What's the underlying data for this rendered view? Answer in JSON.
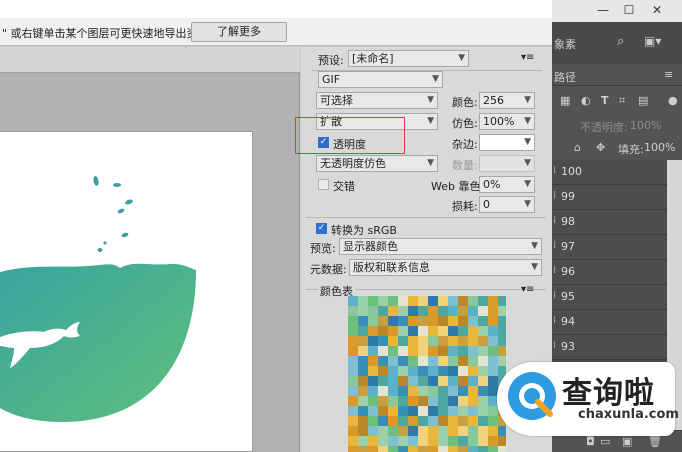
{
  "topbar": {
    "hint": "\" 或右键单击某个图层可更快速地导出资源",
    "learn_more": "了解更多"
  },
  "settings": {
    "preset_label": "预设:",
    "preset_value": "[未命名]",
    "format_value": "GIF",
    "reduction_value": "可选择",
    "colors_label": "颜色:",
    "colors_value": "256",
    "dither_algo_value": "扩散",
    "dither_label": "仿色:",
    "dither_value": "100%",
    "transparency_label": "透明度",
    "matte_label": "杂边:",
    "transparency_dither_value": "无透明度仿色",
    "amount_label": "数量:",
    "interlaced_label": "交错",
    "web_snap_label": "Web 靠色:",
    "web_snap_value": "0%",
    "lossy_label": "损耗:",
    "lossy_value": "0",
    "convert_srgb_label": "转换为 sRGB",
    "preview_label": "预览:",
    "preview_value": "显示器颜色",
    "metadata_label": "元数据:",
    "metadata_value": "版权和联系信息",
    "color_table_label": "颜色表"
  },
  "ps_panel": {
    "window_buttons": [
      "—",
      "☐",
      "✕"
    ],
    "search_hint": "象素",
    "layers_tab": "路径",
    "opacity_label": "不透明度:",
    "opacity_value": "100%",
    "fill_label": "填充:",
    "fill_value": "100%",
    "layers": [
      "100",
      "99",
      "98",
      "97",
      "96",
      "95",
      "94",
      "93"
    ]
  },
  "watermark": {
    "cn": "查询啦",
    "en": "chaxunla.com"
  },
  "colors": {
    "teal": "#3aa89a",
    "green": "#5fbf7a",
    "selected_blue": "#2c6fcf",
    "highlight_red": "#e03a3a"
  },
  "icons": {
    "menu": "menu-icon",
    "checkbox": "checkbox-icon",
    "dropdown": "chevron-down-icon"
  }
}
